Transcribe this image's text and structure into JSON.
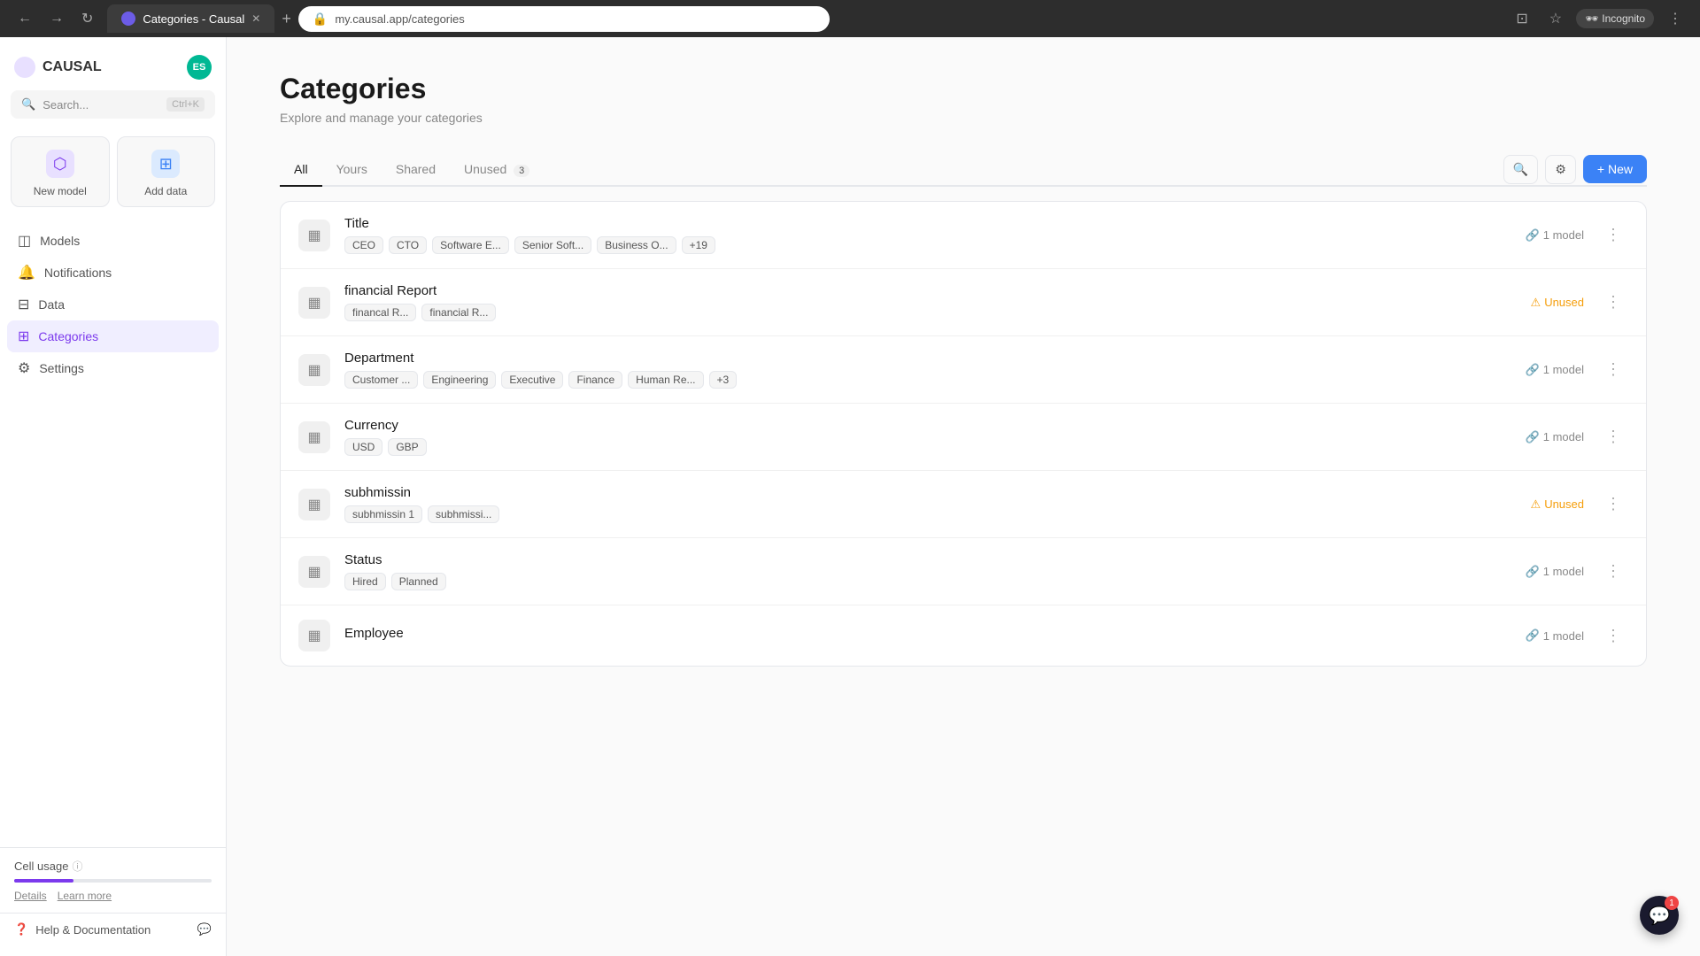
{
  "browser": {
    "tab_title": "Categories - Causal",
    "url": "my.causal.app/categories",
    "incognito_label": "Incognito"
  },
  "sidebar": {
    "logo_text": "CAUSAL",
    "avatar_initials": "ES",
    "search_placeholder": "Search...",
    "search_shortcut": "Ctrl+K",
    "quick_actions": [
      {
        "label": "New model",
        "icon": "⬡"
      },
      {
        "label": "Add data",
        "icon": "⊞"
      }
    ],
    "nav_items": [
      {
        "label": "Models",
        "icon": "◫",
        "active": false
      },
      {
        "label": "Notifications",
        "icon": "🔔",
        "active": false
      },
      {
        "label": "Data",
        "icon": "⊟",
        "active": false
      },
      {
        "label": "Categories",
        "icon": "⊞",
        "active": true
      },
      {
        "label": "Settings",
        "icon": "⚙",
        "active": false
      }
    ],
    "cell_usage_label": "Cell usage",
    "footer_links": [
      "Details",
      "Learn more"
    ],
    "help_label": "Help & Documentation"
  },
  "page": {
    "title": "Categories",
    "subtitle": "Explore and manage your categories"
  },
  "filter_tabs": [
    {
      "label": "All",
      "active": true,
      "badge": null
    },
    {
      "label": "Yours",
      "active": false,
      "badge": null
    },
    {
      "label": "Shared",
      "active": false,
      "badge": null
    },
    {
      "label": "Unused",
      "active": false,
      "badge": "3"
    }
  ],
  "new_button_label": "+ New",
  "categories": [
    {
      "name": "Title",
      "tags": [
        "CEO",
        "CTO",
        "Software E...",
        "Senior Soft...",
        "Business O...",
        "+19"
      ],
      "status_type": "model",
      "status_label": "1 model"
    },
    {
      "name": "financial Report",
      "tags": [
        "financal R...",
        "financial R..."
      ],
      "status_type": "unused",
      "status_label": "Unused"
    },
    {
      "name": "Department",
      "tags": [
        "Customer ...",
        "Engineering",
        "Executive",
        "Finance",
        "Human Re...",
        "+3"
      ],
      "status_type": "model",
      "status_label": "1 model"
    },
    {
      "name": "Currency",
      "tags": [
        "USD",
        "GBP"
      ],
      "status_type": "model",
      "status_label": "1 model"
    },
    {
      "name": "subhmissin",
      "tags": [
        "subhmissin 1",
        "subhmissi..."
      ],
      "status_type": "unused",
      "status_label": "Unused"
    },
    {
      "name": "Status",
      "tags": [
        "Hired",
        "Planned"
      ],
      "status_type": "model",
      "status_label": "1 model"
    },
    {
      "name": "Employee",
      "tags": [],
      "status_type": "model",
      "status_label": "1 model"
    }
  ],
  "chat_badge": "1"
}
